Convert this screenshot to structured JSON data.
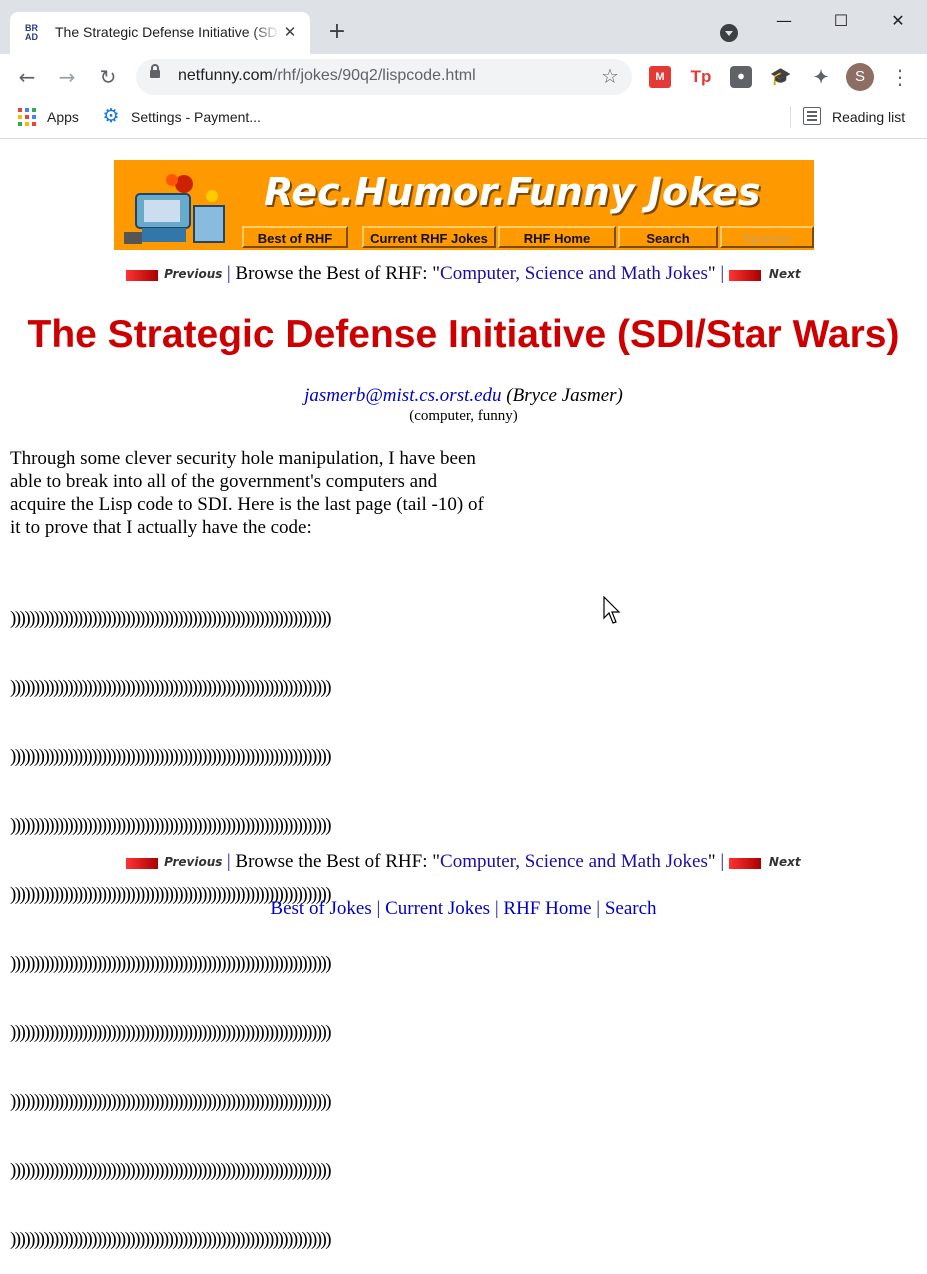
{
  "browser": {
    "tab_title": "The Strategic Defense Initiative (SDI/Star Wars)",
    "favicon_text": "BR AD",
    "url_host": "netfunny.com",
    "url_path": "/rhf/jokes/90q2/lispcode.html",
    "bookmarks": {
      "apps": "Apps",
      "settings": "Settings - Payment...",
      "reading_list": "Reading list"
    },
    "profile_initial": "S",
    "extensions": {
      "mendeley": "M",
      "tp": "Tp",
      "rec": "⏺",
      "cap": "🎓",
      "puzzle": "✦"
    }
  },
  "banner": {
    "title": "Rec.Humor.Funny Jokes",
    "nav": [
      "Best of RHF",
      "Current RHF Jokes",
      "RHF Home",
      "Search",
      "Sponsor"
    ]
  },
  "nav": {
    "previous": "Previous",
    "next": "Next",
    "browse_prefix": "Browse the Best of RHF: \"",
    "category": "Computer, Science and Math Jokes",
    "browse_suffix": "\"",
    "sep": "|"
  },
  "joke": {
    "title": "The Strategic Defense Initiative (SDI/Star Wars)",
    "author_email": "jasmerb@mist.cs.orst.edu",
    "author_name": "(Bryce Jasmer)",
    "keywords": "(computer, funny)",
    "body": "Through some clever security hole manipulation, I have been able to break into all of the government's computers and acquire the Lisp code to SDI. Here is the last page (tail -10) of it to prove that I actually have the code:",
    "code_lines": [
      ")))))))))))))))))))))))))))))))))))))))))))))))))))))))))))))))))))",
      ")))))))))))))))))))))))))))))))))))))))))))))))))))))))))))))))))))",
      ")))))))))))))))))))))))))))))))))))))))))))))))))))))))))))))))))))",
      ")))))))))))))))))))))))))))))))))))))))))))))))))))))))))))))))))))",
      ")))))))))))))))))))))))))))))))))))))))))))))))))))))))))))))))))))",
      ")))))))))))))))))))))))))))))))))))))))))))))))))))))))))))))))))))",
      ")))))))))))))))))))))))))))))))))))))))))))))))))))))))))))))))))))",
      ")))))))))))))))))))))))))))))))))))))))))))))))))))))))))))))))))))",
      ")))))))))))))))))))))))))))))))))))))))))))))))))))))))))))))))))))",
      ")))))))))))))))))))))))))))))))))))))))))))))))))))))))))))))))))))"
    ]
  },
  "footer": {
    "links": [
      "Best of Jokes",
      "Current Jokes",
      "RHF Home",
      "Search"
    ],
    "sep": "|"
  },
  "colors": {
    "banner": "#ff9900",
    "heading": "#cc0000",
    "link": "#1a0dab"
  }
}
